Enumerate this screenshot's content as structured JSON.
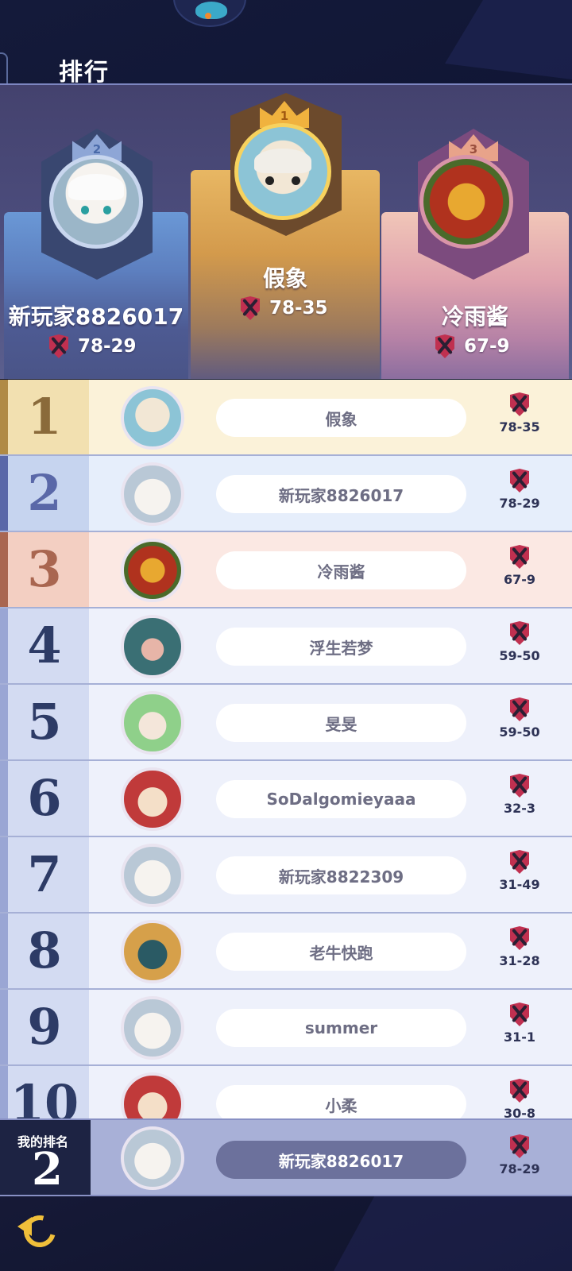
{
  "title": "排行",
  "podium": [
    {
      "place": "2",
      "name": "新玩家8826017",
      "score": "78-29"
    },
    {
      "place": "1",
      "name": "假象",
      "score": "78-35"
    },
    {
      "place": "3",
      "name": "冷雨酱",
      "score": "67-9"
    }
  ],
  "rows": [
    {
      "rank": "1",
      "name": "假象",
      "score": "78-35"
    },
    {
      "rank": "2",
      "name": "新玩家8826017",
      "score": "78-29"
    },
    {
      "rank": "3",
      "name": "冷雨酱",
      "score": "67-9"
    },
    {
      "rank": "4",
      "name": "浮生若梦",
      "score": "59-50"
    },
    {
      "rank": "5",
      "name": "旻旻",
      "score": "59-50"
    },
    {
      "rank": "6",
      "name": "SoDalgomieyaaa",
      "score": "32-3"
    },
    {
      "rank": "7",
      "name": "新玩家8822309",
      "score": "31-49"
    },
    {
      "rank": "8",
      "name": "老牛快跑",
      "score": "31-28"
    },
    {
      "rank": "9",
      "name": "summer",
      "score": "31-1"
    },
    {
      "rank": "10",
      "name": "小柔",
      "score": "30-8"
    }
  ],
  "my_rank": {
    "label": "我的排名",
    "rank": "2",
    "name": "新玩家8826017",
    "score": "78-29"
  },
  "icons": {
    "score": "crossed-swords-shield-icon",
    "back": "back-arrow-icon"
  },
  "colors": {
    "gold": "#f0b23e",
    "silver": "#8ea6d6",
    "bronze": "#e8a38a",
    "list_text": "#2d3255"
  }
}
